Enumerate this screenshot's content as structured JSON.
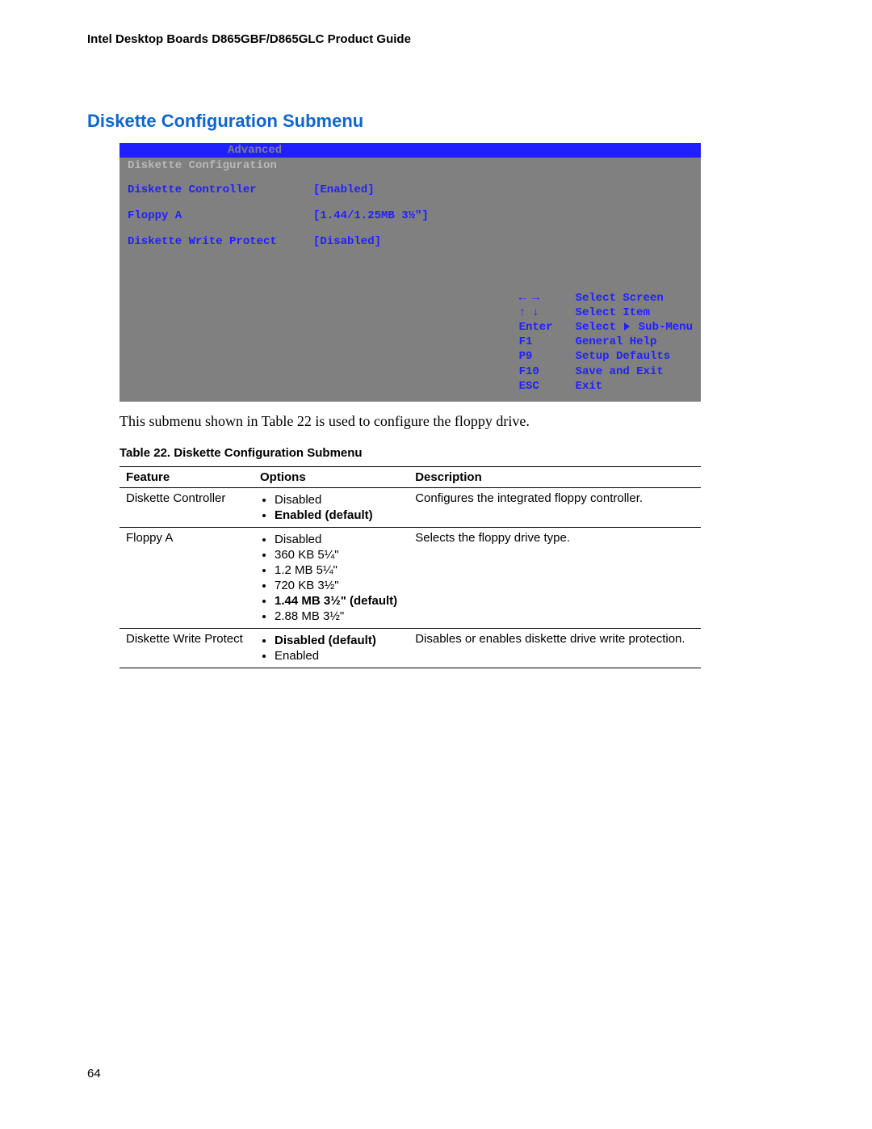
{
  "doc_header": "Intel Desktop Boards D865GBF/D865GLC Product Guide",
  "section_title": "Diskette Configuration Submenu",
  "bios": {
    "tab": "Advanced",
    "screen_title": "Diskette Configuration",
    "items": [
      {
        "label": "Diskette Controller",
        "value": "[Enabled]"
      },
      {
        "label": "Floppy A",
        "value": "[1.44/1.25MB 3½\"]"
      },
      {
        "label": "Diskette Write Protect",
        "value": "[Disabled]"
      }
    ],
    "help": [
      {
        "key": "← →",
        "desc": "Select Screen"
      },
      {
        "key": "↑ ↓",
        "desc": "Select Item"
      },
      {
        "key": "Enter",
        "desc": "Select ▸ Sub-Menu"
      },
      {
        "key": "F1",
        "desc": "General Help"
      },
      {
        "key": "P9",
        "desc": "Setup Defaults"
      },
      {
        "key": "F10",
        "desc": "Save and Exit"
      },
      {
        "key": "ESC",
        "desc": "Exit"
      }
    ]
  },
  "body_text": "This submenu shown in Table 22 is used to configure the floppy drive.",
  "table_caption": "Table 22.    Diskette Configuration Submenu",
  "table": {
    "headers": [
      "Feature",
      "Options",
      "Description"
    ],
    "rows": [
      {
        "feature": "Diskette Controller",
        "options": [
          {
            "text": "Disabled",
            "default": false
          },
          {
            "text": "Enabled (default)",
            "default": true
          }
        ],
        "description": "Configures the integrated floppy controller."
      },
      {
        "feature": "Floppy A",
        "options": [
          {
            "text": "Disabled",
            "default": false
          },
          {
            "text": "360 KB 5¼\"",
            "default": false
          },
          {
            "text": "1.2 MB 5¼\"",
            "default": false
          },
          {
            "text": "720 KB 3½\"",
            "default": false
          },
          {
            "text": "1.44 MB 3½\" (default)",
            "default": true
          },
          {
            "text": "2.88 MB 3½\"",
            "default": false
          }
        ],
        "description": "Selects the floppy drive type."
      },
      {
        "feature": "Diskette Write Protect",
        "options": [
          {
            "text": "Disabled (default)",
            "default": true
          },
          {
            "text": "Enabled",
            "default": false
          }
        ],
        "description": "Disables or enables diskette drive write protection."
      }
    ]
  },
  "page_number": "64"
}
